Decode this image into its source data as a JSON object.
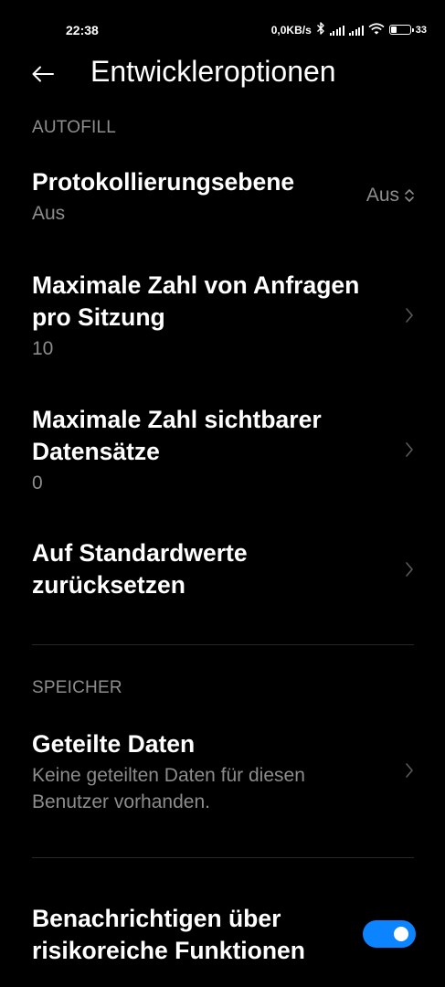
{
  "status_bar": {
    "time": "22:38",
    "network_speed": "0,0KB/s",
    "battery_percent": "33",
    "battery_level": 0.33
  },
  "header": {
    "title": "Entwickleroptionen"
  },
  "sections": {
    "autofill": {
      "header": "AUTOFILL",
      "log_level": {
        "title": "Protokollierungsebene",
        "value": "Aus",
        "dropdown_value": "Aus"
      },
      "max_requests": {
        "title_line1": "Maximale Zahl von Anfragen",
        "title_line2": "pro Sitzung",
        "value": "10"
      },
      "max_datasets": {
        "title_line1": "Maximale Zahl sichtbarer",
        "title_line2": "Datensätze",
        "value": "0"
      },
      "reset": {
        "title_line1": "Auf Standardwerte",
        "title_line2": "zurücksetzen"
      }
    },
    "storage": {
      "header": "SPEICHER",
      "shared_data": {
        "title": "Geteilte Daten",
        "desc_line1": "Keine geteilten Daten für diesen",
        "desc_line2": "Benutzer vorhanden."
      }
    },
    "risky": {
      "title_line1": "Benachrichtigen über",
      "title_line2": "risikoreiche Funktionen",
      "toggle_on": true
    }
  },
  "colors": {
    "background": "#000000",
    "accent": "#0d84ff",
    "secondary_text": "#8c8c8c"
  }
}
